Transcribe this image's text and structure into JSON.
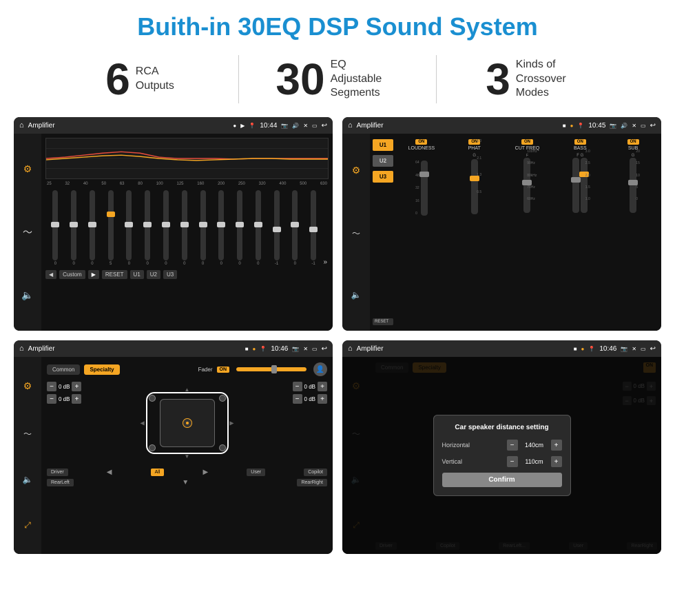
{
  "page": {
    "title": "Buith-in 30EQ DSP Sound System",
    "stats": [
      {
        "number": "6",
        "text": "RCA\nOutputs"
      },
      {
        "number": "30",
        "text": "EQ Adjustable\nSegments"
      },
      {
        "number": "3",
        "text": "Kinds of\nCrossover Modes"
      }
    ]
  },
  "screens": {
    "top_left": {
      "status": {
        "title": "Amplifier",
        "time": "10:44"
      },
      "eq_bands": [
        "25",
        "32",
        "40",
        "50",
        "63",
        "80",
        "100",
        "125",
        "160",
        "200",
        "250",
        "320",
        "400",
        "500",
        "630"
      ],
      "eq_values": [
        "0",
        "0",
        "0",
        "5",
        "0",
        "0",
        "0",
        "0",
        "0",
        "0",
        "0",
        "0",
        "-1",
        "0",
        "-1"
      ],
      "preset": "Custom",
      "buttons": [
        "RESET",
        "U1",
        "U2",
        "U3"
      ]
    },
    "top_right": {
      "status": {
        "title": "Amplifier",
        "time": "10:45"
      },
      "u_buttons": [
        "U1",
        "U2",
        "U3"
      ],
      "channels": [
        {
          "name": "LOUDNESS",
          "on": true,
          "value": ""
        },
        {
          "name": "PHAT",
          "on": true,
          "value": "G"
        },
        {
          "name": "CUT FREQ",
          "on": true,
          "value": "F"
        },
        {
          "name": "BASS",
          "on": true,
          "value": "F G"
        },
        {
          "name": "SUB",
          "on": true,
          "value": "G"
        }
      ],
      "reset": "RESET"
    },
    "bottom_left": {
      "status": {
        "title": "Amplifier",
        "time": "10:46"
      },
      "tabs": [
        "Common",
        "Specialty"
      ],
      "fader_label": "Fader",
      "fader_on": "ON",
      "channels": [
        {
          "label": "0 dB",
          "side": "left-top"
        },
        {
          "label": "0 dB",
          "side": "left-bottom"
        },
        {
          "label": "0 dB",
          "side": "right-top"
        },
        {
          "label": "0 dB",
          "side": "right-bottom"
        }
      ],
      "buttons": [
        "Driver",
        "Copilot",
        "RearLeft",
        "All",
        "User",
        "RearRight"
      ]
    },
    "bottom_right": {
      "status": {
        "title": "Amplifier",
        "time": "10:46"
      },
      "tabs": [
        "Common",
        "Specialty"
      ],
      "fader_on": "ON",
      "dialog": {
        "title": "Car speaker distance setting",
        "fields": [
          {
            "label": "Horizontal",
            "value": "140cm"
          },
          {
            "label": "Vertical",
            "value": "110cm"
          }
        ],
        "confirm": "Confirm"
      },
      "channels": [
        {
          "label": "0 dB"
        },
        {
          "label": "0 dB"
        }
      ],
      "buttons": [
        "Driver",
        "Copilot",
        "RearLeft",
        "User",
        "RearRight"
      ]
    }
  }
}
